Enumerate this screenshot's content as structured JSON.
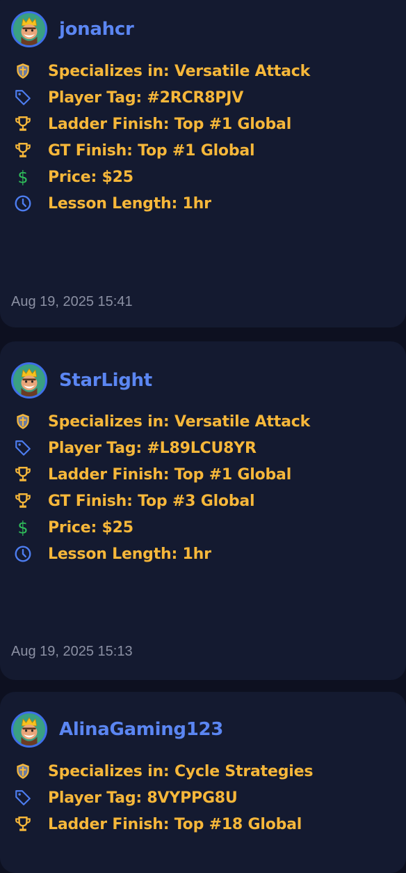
{
  "posts": [
    {
      "username": "jonahcr",
      "specializes": "Specializes in: Versatile Attack",
      "player_tag": "Player Tag: #2RCR8PJV",
      "ladder_finish": "Ladder Finish: Top #1 Global",
      "gt_finish": "GT Finish: Top #1 Global",
      "price": "Price: $25",
      "lesson_length": "Lesson Length: 1hr",
      "timestamp": "Aug 19, 2025 15:41"
    },
    {
      "username": "StarLight",
      "specializes": "Specializes in: Versatile Attack",
      "player_tag": "Player Tag: #L89LCU8YR",
      "ladder_finish": "Ladder Finish: Top #1 Global",
      "gt_finish": "GT Finish: Top #3 Global",
      "price": "Price: $25",
      "lesson_length": "Lesson Length: 1hr",
      "timestamp": "Aug 19, 2025 15:13"
    },
    {
      "username": "AlinaGaming123",
      "specializes": "Specializes in: Cycle Strategies",
      "player_tag": "Player Tag: 8VYPPG8U",
      "ladder_finish": "Ladder Finish: Top #18 Global"
    }
  ],
  "icons": {
    "shield": "shield-icon",
    "tag": "tag-icon",
    "trophy": "trophy-icon",
    "dollar": "dollar-icon",
    "clock": "clock-icon"
  },
  "colors": {
    "background": "#0d1020",
    "card": "#141a30",
    "username": "#5b86f2",
    "text": "#f6b73a",
    "tag_icon": "#4d7df0",
    "dollar_icon": "#2fbe5a",
    "timestamp": "#8b90a3"
  }
}
